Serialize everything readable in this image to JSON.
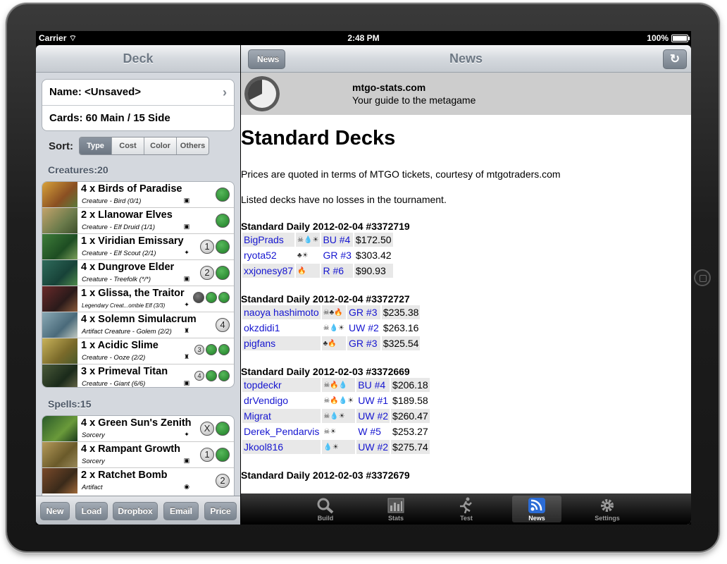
{
  "status": {
    "carrier": "Carrier",
    "time": "2:48 PM",
    "battery": "100%"
  },
  "deck": {
    "title": "Deck",
    "name_row": "Name: <Unsaved>",
    "cards_row": "Cards: 60 Main  / 15 Side",
    "sort_label": "Sort:",
    "sort_options": [
      "Type",
      "Cost",
      "Color",
      "Others"
    ],
    "creatures_header": "Creatures:20",
    "creatures": [
      {
        "name": "4 x Birds of Paradise",
        "type": "Creature  - Bird (0/1)",
        "set": "M12"
      },
      {
        "name": "2 x Llanowar Elves",
        "type": "Creature  - Elf Druid (1/1)",
        "set": "M12"
      },
      {
        "name": "1 x Viridian Emissary",
        "type": "Creature  - Elf Scout (2/1)",
        "set": "MBS",
        "cost": "1"
      },
      {
        "name": "4 x Dungrove Elder",
        "type": "Creature  - Treefolk (*/*)",
        "set": "M12",
        "cost": "2"
      },
      {
        "name": "1 x Glissa, the Traitor",
        "type": "Legendary Creat...ombie Elf (3/3)",
        "set": "MBS"
      },
      {
        "name": "4 x Solemn Simulacrum",
        "type": "Artifact Creature  - Golem (2/2)",
        "set": "SOM",
        "cost": "4"
      },
      {
        "name": "1 x Acidic Slime",
        "type": "Creature  - Ooze (2/2)",
        "set": "SOM",
        "cost": "3"
      },
      {
        "name": "3 x Primeval Titan",
        "type": "Creature  - Giant (6/6)",
        "set": "M12",
        "cost": "4"
      }
    ],
    "spells_header": "Spells:15",
    "spells": [
      {
        "name": "4 x Green Sun's Zenith",
        "type": "Sorcery",
        "set": "MBS",
        "cost": "X"
      },
      {
        "name": "4 x Rampant Growth",
        "type": "Sorcery",
        "set": "M12",
        "cost": "1"
      },
      {
        "name": "2 x Ratchet Bomb",
        "type": "Artifact",
        "set": "SOM",
        "cost": "2"
      }
    ],
    "toolbar": [
      "New",
      "Load",
      "Dropbox",
      "Email",
      "Price"
    ]
  },
  "news": {
    "back": "News",
    "title": "News",
    "site": "mtgo-stats.com",
    "tagline": "Your guide to the metagame",
    "heading": "Standard Decks",
    "p1": "Prices are quoted in terms of MTGO tickets, courtesy of mtgotraders.com",
    "p2": "Listed decks have no losses in the tournament.",
    "events": [
      {
        "title": "Standard Daily 2012-02-04 #3372719",
        "rows": [
          {
            "player": "BigPrads",
            "sym": "☠💧☀",
            "arch": "BU #4",
            "price": "$172.50"
          },
          {
            "player": "ryota52",
            "sym": "♣☀",
            "arch": "GR #3",
            "price": "$303.42"
          },
          {
            "player": "xxjonesy87",
            "sym": "🔥",
            "arch": "R #6",
            "price": "$90.93"
          }
        ]
      },
      {
        "title": "Standard Daily 2012-02-04 #3372727",
        "rows": [
          {
            "player": "naoya hashimoto",
            "sym": "☠♣🔥",
            "arch": "GR #3",
            "price": "$235.38"
          },
          {
            "player": "okzdidi1",
            "sym": "☠💧☀",
            "arch": "UW #2",
            "price": "$263.16"
          },
          {
            "player": "pigfans",
            "sym": "♣🔥",
            "arch": "GR #3",
            "price": "$325.54"
          }
        ]
      },
      {
        "title": "Standard Daily 2012-02-03 #3372669",
        "rows": [
          {
            "player": "topdeckr",
            "sym": "☠🔥💧",
            "arch": "BU #4",
            "price": "$206.18"
          },
          {
            "player": "drVendigo",
            "sym": "☠🔥💧☀",
            "arch": "UW #1",
            "price": "$189.58"
          },
          {
            "player": "Migrat",
            "sym": "☠💧☀",
            "arch": "UW #2",
            "price": "$260.47"
          },
          {
            "player": "Derek_Pendarvis",
            "sym": "☠☀",
            "arch": "W #5",
            "price": "$253.27"
          },
          {
            "player": "Jkool816",
            "sym": "💧☀",
            "arch": "UW #2",
            "price": "$275.74"
          }
        ]
      },
      {
        "title": "Standard Daily 2012-02-03 #3372679",
        "rows": []
      }
    ],
    "tabs": [
      "Build",
      "Stats",
      "Test",
      "News",
      "Settings"
    ]
  },
  "colors": {
    "accent": "#1515d0",
    "green_mana": "#2e8b35",
    "selected_tab": "#2b6cd6"
  }
}
